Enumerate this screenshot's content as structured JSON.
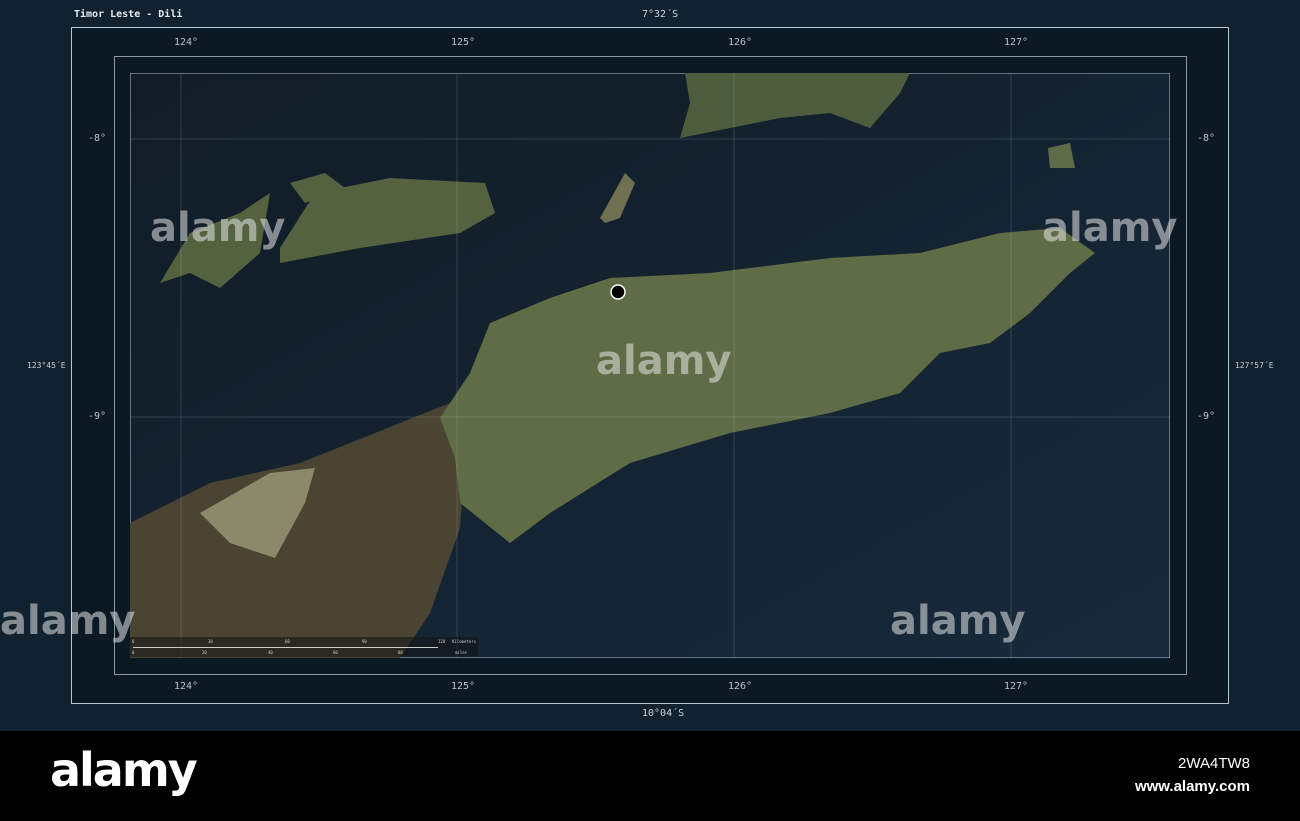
{
  "map": {
    "title": "Timor Leste - Dili",
    "top_lat": "7°32´S",
    "bottom_lat": "10°04´S",
    "left_lon": "123°45´E",
    "right_lon": "127°57´E",
    "lon_ticks": [
      "124°",
      "125°",
      "126°",
      "127°"
    ],
    "lat_ticks": [
      "-8°",
      "-9°"
    ],
    "scale": {
      "km_ticks": [
        "0",
        "30",
        "60",
        "90",
        "120"
      ],
      "km_unit": "Kilometers",
      "mi_ticks": [
        "0",
        "20",
        "40",
        "60",
        "80"
      ],
      "mi_unit": "miles"
    },
    "marker": "Dili"
  },
  "watermark": {
    "brand": "alamy",
    "image_id": "2WA4TW8",
    "url": "www.alamy.com"
  },
  "colors": {
    "sea": "#0f1d29",
    "land": "#5b6a44",
    "frame_bg": "#10222f"
  }
}
